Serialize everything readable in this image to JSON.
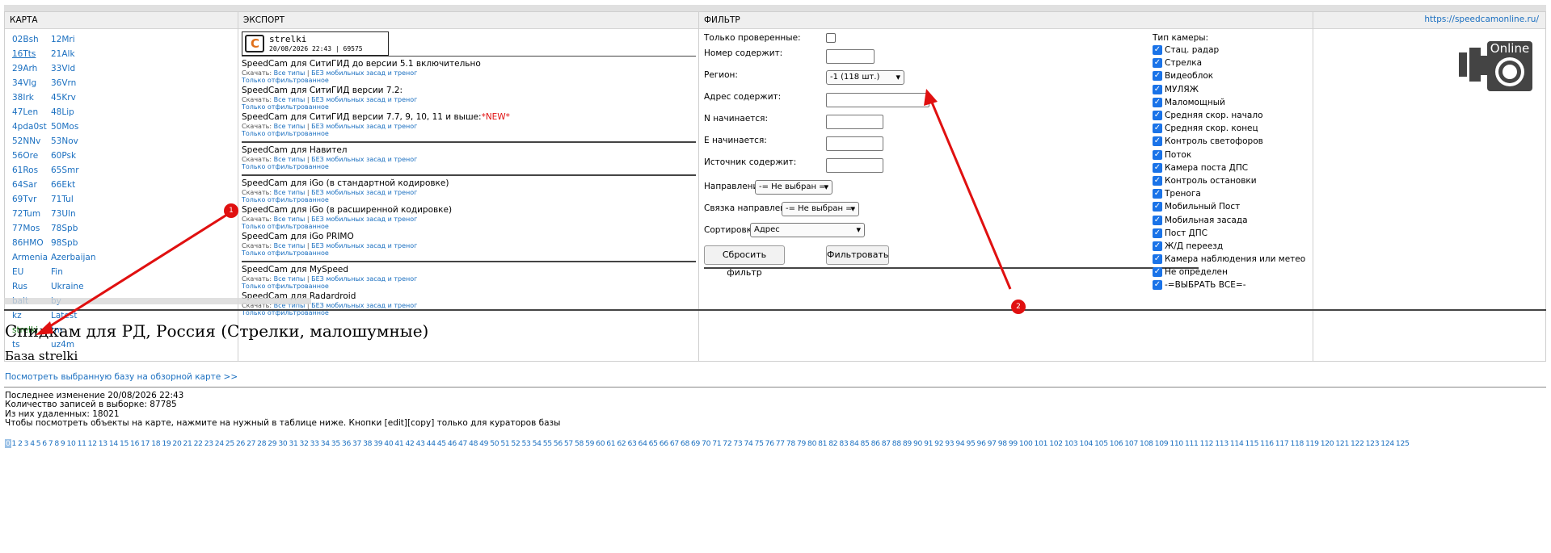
{
  "panels": {
    "map": {
      "title": "КАРТА"
    },
    "export": {
      "title": "ЭКСПОРТ"
    },
    "filter": {
      "title": "ФИЛЬТР"
    },
    "site": {
      "link": "https://speedcamonline.ru/"
    }
  },
  "regions": [
    "02Bsh",
    "12Mri",
    "16Tts",
    "21Alk",
    "29Arh",
    "33Vld",
    "34Vlg",
    "36Vrn",
    "38Irk",
    "45Krv",
    "47Len",
    "48Lip",
    "4pda0st",
    "50Mos",
    "52NNv",
    "53Nov",
    "56Ore",
    "60Psk",
    "61Ros",
    "65Smr",
    "64Sar",
    "66Ekt",
    "69Tvr",
    "71Tul",
    "72Tum",
    "73Uln",
    "77Mos",
    "78Spb",
    "86HMO",
    "98Spb",
    "Armenia",
    "Azerbaijan",
    "EU",
    "Fin",
    "Rus",
    "Ukraine",
    "balt",
    "by",
    "kz",
    "Latest",
    "strelki",
    "tm",
    "ts",
    "uz4m"
  ],
  "export": {
    "logo_title": "strelki",
    "logo_sub": "20/08/2026 22:43 | 69575",
    "dl_prefix": "Скачать:",
    "dl_all": "Все типы",
    "dl_sep": "|",
    "dl_nomobile": "БЕЗ мобильных засад и треног",
    "only_filtered": "Только отфильтрованное",
    "groups": [
      [
        {
          "title": "SpeedCam для СитиГИД до версии 5.1 включительно",
          "new": ""
        },
        {
          "title": "SpeedCam для СитиГИД версии 7.2:",
          "new": ""
        },
        {
          "title": "SpeedCam для СитиГИД версии 7.7, 9, 10, 11 и выше:",
          "new": "*NEW*"
        }
      ],
      [
        {
          "title": "SpeedCam для Навител",
          "new": ""
        }
      ],
      [
        {
          "title": "SpeedCam для iGo (в стандартной кодировке)",
          "new": ""
        },
        {
          "title": "SpeedCam для iGo (в расширенной кодировке)",
          "new": ""
        },
        {
          "title": "SpeedCam для iGo PRIMO",
          "new": ""
        }
      ],
      [
        {
          "title": "SpeedCam для MySpeed",
          "new": ""
        },
        {
          "title": "SpeedCam для Radardroid",
          "new": ""
        }
      ]
    ]
  },
  "filter": {
    "verified_label": "Только проверенные:",
    "number_label": "Номер содержит:",
    "region_label": "Регион:",
    "region_value": "-1 (118 шт.)",
    "address_label": "Адрес содержит:",
    "n_label": "N начинается:",
    "e_label": "E начинается:",
    "source_label": "Источник содержит:",
    "direction_label": "Направление:",
    "direction_value": "-= Не выбран =-",
    "link_label": "Связка направлений:",
    "link_value": "-= Не выбран =-",
    "sort_label": "Сортировка:",
    "sort_value": "Адрес",
    "reset_button": "Сбросить фильтр",
    "apply_button": "Фильтровать",
    "types_label": "Тип камеры:",
    "types": [
      "Стац. радар",
      "Стрелка",
      "Видеоблок",
      "МУЛЯЖ",
      "Маломощный",
      "Средняя скор. начало",
      "Средняя скор. конец",
      "Контроль светофоров",
      "Поток",
      "Камера поста ДПС",
      "Контроль остановки",
      "Тренога",
      "Мобильный Пост",
      "Мобильная засада",
      "Пост ДПС",
      "Ж/Д переезд",
      "Камера наблюдения или метео",
      "Не определен",
      "-=ВЫБРАТЬ ВСЕ=-"
    ]
  },
  "logo_text": "Online",
  "main": {
    "title": "Спидкам для РД, Россия (Стрелки, малошумные)",
    "subtitle": "База strelki",
    "map_link": "Посмотреть выбранную базу на обзорной карте >>",
    "info": [
      "Последнее изменение 20/08/2026 22:43",
      "Количество записей в выборке: 87785",
      "Из них удаленных: 18021",
      "Чтобы посмотреть объекты на карте, нажмите на нужный в таблице ниже. Кнопки [edit][copy] только для кураторов базы"
    ]
  },
  "pagination": {
    "current": "0",
    "last": 125
  },
  "markers": [
    "1",
    "2"
  ],
  "colors": {
    "link": "#1a6fc0",
    "accent_check": "#1a73e8",
    "arrow": "#e01010"
  }
}
